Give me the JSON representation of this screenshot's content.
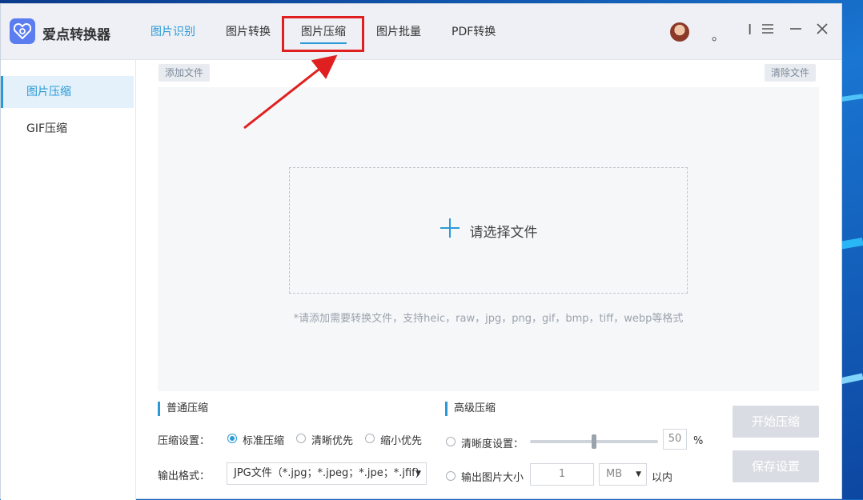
{
  "app": {
    "title": "爱点转换器"
  },
  "nav": {
    "tabs": [
      {
        "label": "图片识别"
      },
      {
        "label": "图片转换"
      },
      {
        "label": "图片压缩"
      },
      {
        "label": "图片批量"
      },
      {
        "label": "PDF转换"
      }
    ],
    "active_tab": "图片压缩"
  },
  "window_controls": {
    "dot": "。",
    "divider": "I"
  },
  "sidebar": {
    "items": [
      {
        "label": "图片压缩",
        "active": true
      },
      {
        "label": "GIF压缩",
        "active": false
      }
    ]
  },
  "toolbar": {
    "add_file": "添加文件",
    "clear_files": "清除文件"
  },
  "dropzone": {
    "label": "请选择文件",
    "hint": "*请添加需要转换文件，支持heic，raw，jpg，png，gif，bmp，tiff，webp等格式"
  },
  "normal": {
    "section_title": "普通压缩",
    "setting_label": "压缩设置：",
    "options": [
      "标准压缩",
      "清晰优先",
      "缩小优先"
    ],
    "selected": "标准压缩",
    "format_label": "输出格式：",
    "format_value": "JPG文件（*.jpg；*.jpeg；*.jpe；*.jfif)"
  },
  "advanced": {
    "section_title": "高级压缩",
    "clarity_label": "清晰度设置：",
    "clarity_value": "50",
    "clarity_unit": "%",
    "size_label": "输出图片大小",
    "size_value": "1",
    "size_unit": "MB",
    "size_suffix": "以内"
  },
  "actions": {
    "start": "开始压缩",
    "save": "保存设置"
  },
  "colors": {
    "accent": "#2a9ad6",
    "highlight": "#e02020"
  }
}
